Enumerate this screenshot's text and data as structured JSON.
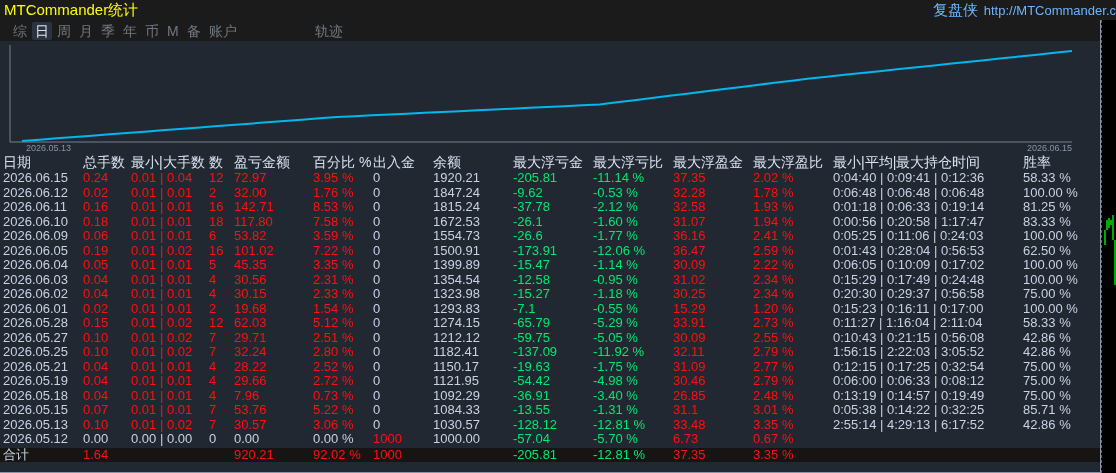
{
  "title": "MTCommander统计",
  "brand": {
    "name": "复盘侠",
    "link": "http://MTCommander.c"
  },
  "tabs": [
    {
      "label": "综",
      "selected": false
    },
    {
      "label": "日",
      "selected": true
    },
    {
      "label": "周",
      "selected": false
    },
    {
      "label": "月",
      "selected": false
    },
    {
      "label": "季",
      "selected": false
    },
    {
      "label": "年",
      "selected": false
    },
    {
      "label": "币",
      "selected": false
    },
    {
      "label": "M",
      "selected": false
    },
    {
      "label": "备",
      "selected": false
    },
    {
      "label": "账户",
      "selected": false
    },
    {
      "label": "轨迹",
      "selected": false
    }
  ],
  "chart": {
    "start_label": "2026.05.13",
    "end_label": "2026.06.15"
  },
  "table": {
    "columns": [
      "日期",
      "总手数",
      "最小|大手数",
      "数",
      "盈亏金额",
      "百分比 %",
      "出入金",
      "余额",
      "最大浮亏金",
      "最大浮亏比",
      "最大浮盈金",
      "最大浮盈比",
      "最小|平均|最大持仓时间",
      "胜率"
    ],
    "rows": [
      {
        "kind": "trade",
        "cells": [
          "2026.06.15",
          "0.24",
          "0.01 | 0.04",
          "12",
          "72.97",
          "3.95 %",
          "0",
          "1920.21",
          "-205.81",
          "-11.14 %",
          "37.35",
          "2.02 %",
          "0:04:40 | 0:09:41 | 0:12:36",
          "58.33 %"
        ]
      },
      {
        "kind": "trade",
        "cells": [
          "2026.06.12",
          "0.02",
          "0.01 | 0.01",
          "2",
          "32.00",
          "1.76 %",
          "0",
          "1847.24",
          "-9.62",
          "-0.53 %",
          "32.28",
          "1.78 %",
          "0:06:48 | 0:06:48 | 0:06:48",
          "100.00 %"
        ]
      },
      {
        "kind": "trade",
        "cells": [
          "2026.06.11",
          "0.16",
          "0.01 | 0.01",
          "16",
          "142.71",
          "8.53 %",
          "0",
          "1815.24",
          "-37.78",
          "-2.12 %",
          "32.58",
          "1.93 %",
          "0:01:18 | 0:06:33 | 0:19:14",
          "81.25 %"
        ]
      },
      {
        "kind": "trade",
        "cells": [
          "2026.06.10",
          "0.18",
          "0.01 | 0.01",
          "18",
          "117.80",
          "7.58 %",
          "0",
          "1672.53",
          "-26.1",
          "-1.60 %",
          "31.07",
          "1.94 %",
          "0:00:56 | 0:20:58 | 1:17:47",
          "83.33 %"
        ]
      },
      {
        "kind": "trade",
        "cells": [
          "2026.06.09",
          "0.06",
          "0.01 | 0.01",
          "6",
          "53.82",
          "3.59 %",
          "0",
          "1554.73",
          "-26.6",
          "-1.77 %",
          "36.16",
          "2.41 %",
          "0:05:25 | 0:11:06 | 0:24:03",
          "100.00 %"
        ]
      },
      {
        "kind": "trade",
        "cells": [
          "2026.06.05",
          "0.19",
          "0.01 | 0.02",
          "16",
          "101.02",
          "7.22 %",
          "0",
          "1500.91",
          "-173.91",
          "-12.06 %",
          "36.47",
          "2.59 %",
          "0:01:43 | 0:28:04 | 0:56:53",
          "62.50 %"
        ]
      },
      {
        "kind": "trade",
        "cells": [
          "2026.06.04",
          "0.05",
          "0.01 | 0.01",
          "5",
          "45.35",
          "3.35 %",
          "0",
          "1399.89",
          "-15.47",
          "-1.14 %",
          "30.09",
          "2.22 %",
          "0:06:05 | 0:10:09 | 0:17:02",
          "100.00 %"
        ]
      },
      {
        "kind": "trade",
        "cells": [
          "2026.06.03",
          "0.04",
          "0.01 | 0.01",
          "4",
          "30.56",
          "2.31 %",
          "0",
          "1354.54",
          "-12.58",
          "-0.95 %",
          "31.02",
          "2.34 %",
          "0:15:29 | 0:17:49 | 0:24:48",
          "100.00 %"
        ]
      },
      {
        "kind": "trade",
        "cells": [
          "2026.06.02",
          "0.04",
          "0.01 | 0.01",
          "4",
          "30.15",
          "2.33 %",
          "0",
          "1323.98",
          "-15.27",
          "-1.18 %",
          "30.25",
          "2.34 %",
          "0:20:30 | 0:29:37 | 0:56:58",
          "75.00 %"
        ]
      },
      {
        "kind": "trade",
        "cells": [
          "2026.06.01",
          "0.02",
          "0.01 | 0.01",
          "2",
          "19.68",
          "1.54 %",
          "0",
          "1293.83",
          "-7.1",
          "-0.55 %",
          "15.29",
          "1.20 %",
          "0:15:23 | 0:16:11 | 0:17:00",
          "100.00 %"
        ]
      },
      {
        "kind": "trade",
        "cells": [
          "2026.05.28",
          "0.15",
          "0.01 | 0.02",
          "12",
          "62.03",
          "5.12 %",
          "0",
          "1274.15",
          "-65.79",
          "-5.29 %",
          "33.91",
          "2.73 %",
          "0:11:27 | 1:16:04 | 2:11:04",
          "58.33 %"
        ]
      },
      {
        "kind": "trade",
        "cells": [
          "2026.05.27",
          "0.10",
          "0.01 | 0.02",
          "7",
          "29.71",
          "2.51 %",
          "0",
          "1212.12",
          "-59.75",
          "-5.05 %",
          "30.09",
          "2.55 %",
          "0:10:43 | 0:21:15 | 0:56:08",
          "42.86 %"
        ]
      },
      {
        "kind": "trade",
        "cells": [
          "2026.05.25",
          "0.10",
          "0.01 | 0.02",
          "7",
          "32.24",
          "2.80 %",
          "0",
          "1182.41",
          "-137.09",
          "-11.92 %",
          "32.11",
          "2.79 %",
          "1:56:15 | 2:22:03 | 3:05:52",
          "42.86 %"
        ]
      },
      {
        "kind": "trade",
        "cells": [
          "2026.05.21",
          "0.04",
          "0.01 | 0.01",
          "4",
          "28.22",
          "2.52 %",
          "0",
          "1150.17",
          "-19.63",
          "-1.75 %",
          "31.09",
          "2.77 %",
          "0:12:15 | 0:17:25 | 0:32:54",
          "75.00 %"
        ]
      },
      {
        "kind": "trade",
        "cells": [
          "2026.05.19",
          "0.04",
          "0.01 | 0.01",
          "4",
          "29.66",
          "2.72 %",
          "0",
          "1121.95",
          "-54.42",
          "-4.98 %",
          "30.46",
          "2.79 %",
          "0:06:00 | 0:06:33 | 0:08:12",
          "75.00 %"
        ]
      },
      {
        "kind": "trade",
        "cells": [
          "2026.05.18",
          "0.04",
          "0.01 | 0.01",
          "4",
          "7.96",
          "0.73 %",
          "0",
          "1092.29",
          "-36.91",
          "-3.40 %",
          "26.85",
          "2.48 %",
          "0:13:19 | 0:14:57 | 0:19:49",
          "75.00 %"
        ]
      },
      {
        "kind": "trade",
        "cells": [
          "2026.05.15",
          "0.07",
          "0.01 | 0.01",
          "7",
          "53.76",
          "5.22 %",
          "0",
          "1084.33",
          "-13.55",
          "-1.31 %",
          "31.1",
          "3.01 %",
          "0:05:38 | 0:14:22 | 0:32:25",
          "85.71 %"
        ]
      },
      {
        "kind": "trade",
        "cells": [
          "2026.05.13",
          "0.10",
          "0.01 | 0.02",
          "7",
          "30.57",
          "3.06 %",
          "0",
          "1030.57",
          "-128.12",
          "-12.81 %",
          "33.48",
          "3.35 %",
          "2:55:14 | 4:29:13 | 6:17:52",
          "42.86 %"
        ]
      },
      {
        "kind": "deposit",
        "cells": [
          "2026.05.12",
          "0.00",
          "0.00 | 0.00",
          "0",
          "0.00",
          "0.00 %",
          "1000",
          "1000.00",
          "-57.04",
          "-5.70 %",
          "6.73",
          "0.67 %"
        ]
      }
    ],
    "total": {
      "label": "合计",
      "lots": "1.64",
      "pnl": "920.21",
      "pct": "92.02 %",
      "flow": "1000",
      "max_loss": "-205.81",
      "max_loss_pct": "-12.81 %",
      "max_profit": "37.35",
      "max_profit_pct": "3.35 %"
    }
  }
}
